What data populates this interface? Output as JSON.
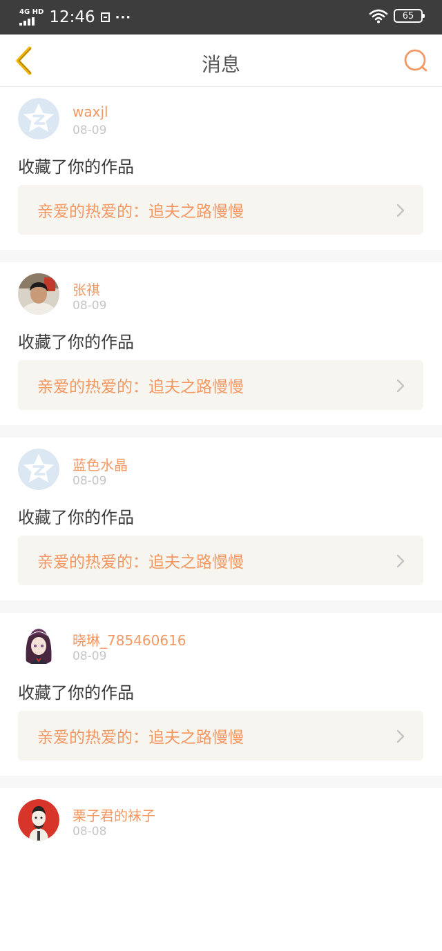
{
  "status_bar": {
    "network": "4G HD",
    "time": "12:46",
    "dots": "···",
    "battery": "65"
  },
  "header": {
    "title": "消息"
  },
  "messages": [
    {
      "username": "waxjl",
      "date": "08-09",
      "action": "收藏了你的作品",
      "work_title": "亲爱的热爱的：追夫之路慢慢",
      "avatar": "qzone-default-avatar"
    },
    {
      "username": "张祺",
      "date": "08-09",
      "action": "收藏了你的作品",
      "work_title": "亲爱的热爱的：追夫之路慢慢",
      "avatar": "photo-avatar"
    },
    {
      "username": "蓝色水晶",
      "date": "08-09",
      "action": "收藏了你的作品",
      "work_title": "亲爱的热爱的：追夫之路慢慢",
      "avatar": "qzone-default-avatar"
    },
    {
      "username": "晓琳_785460616",
      "date": "08-09",
      "action": "收藏了你的作品",
      "work_title": "亲爱的热爱的：追夫之路慢慢",
      "avatar": "anime-girl-avatar"
    },
    {
      "username": "栗子君的袜子",
      "date": "08-08",
      "avatar": "illustrated-avatar"
    }
  ],
  "colors": {
    "accent": "#f39863",
    "back_icon": "#f2b300",
    "status_bar_bg": "#3d3d3d",
    "card_bg": "#ffffff",
    "link_bg": "#f6f5ef"
  }
}
